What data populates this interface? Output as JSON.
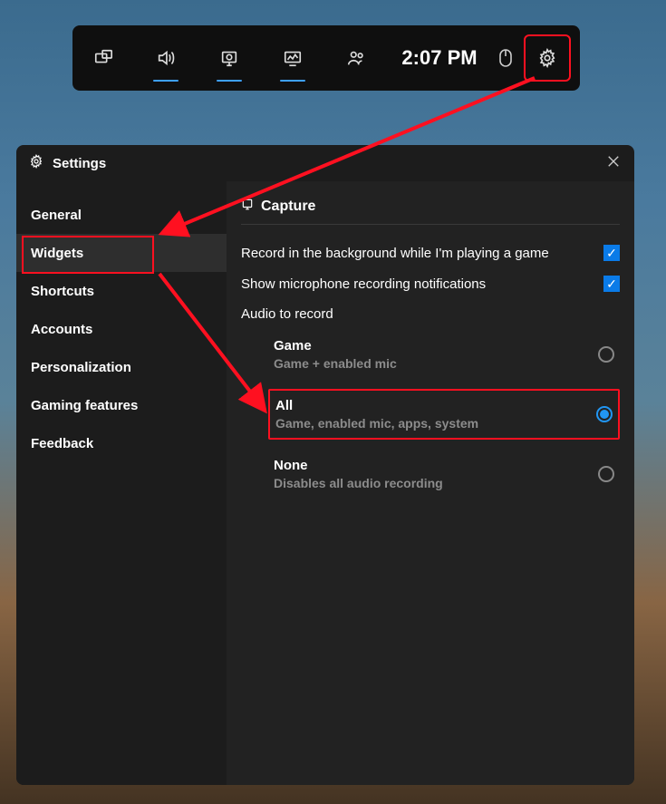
{
  "gamebar": {
    "clock": "2:07 PM"
  },
  "settings": {
    "title": "Settings",
    "sidebar": {
      "items": [
        {
          "label": "General"
        },
        {
          "label": "Widgets"
        },
        {
          "label": "Shortcuts"
        },
        {
          "label": "Accounts"
        },
        {
          "label": "Personalization"
        },
        {
          "label": "Gaming features"
        },
        {
          "label": "Feedback"
        }
      ]
    },
    "capture": {
      "section_label": "Capture",
      "record_bg_label": "Record in the background while I'm playing a game",
      "mic_notif_label": "Show microphone recording notifications",
      "audio_to_record_label": "Audio to record",
      "options": {
        "game": {
          "title": "Game",
          "desc": "Game + enabled mic"
        },
        "all": {
          "title": "All",
          "desc": "Game, enabled mic, apps, system"
        },
        "none": {
          "title": "None",
          "desc": "Disables all audio recording"
        }
      }
    }
  }
}
